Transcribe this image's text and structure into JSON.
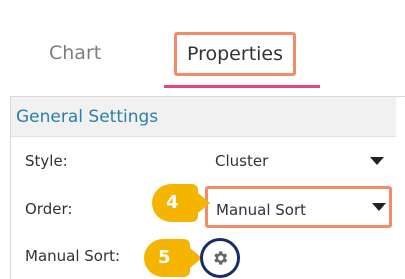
{
  "tabs": {
    "chart": "Chart",
    "properties": "Properties"
  },
  "section": {
    "title": "General Settings"
  },
  "fields": {
    "style": {
      "label": "Style:",
      "value": "Cluster"
    },
    "order": {
      "label": "Order:",
      "value": "Manual Sort"
    },
    "manual_sort": {
      "label": "Manual Sort:"
    }
  },
  "badges": {
    "step4": "4",
    "step5": "5"
  },
  "icons": {
    "dropdown": "chevron-down-icon",
    "settings": "gear-icon"
  },
  "colors": {
    "highlight": "#f28b66",
    "active_tab_underline": "#e8457f",
    "section_title": "#2a7fa8",
    "badge": "#f4b400",
    "gear_ring": "#1b2a6b"
  }
}
